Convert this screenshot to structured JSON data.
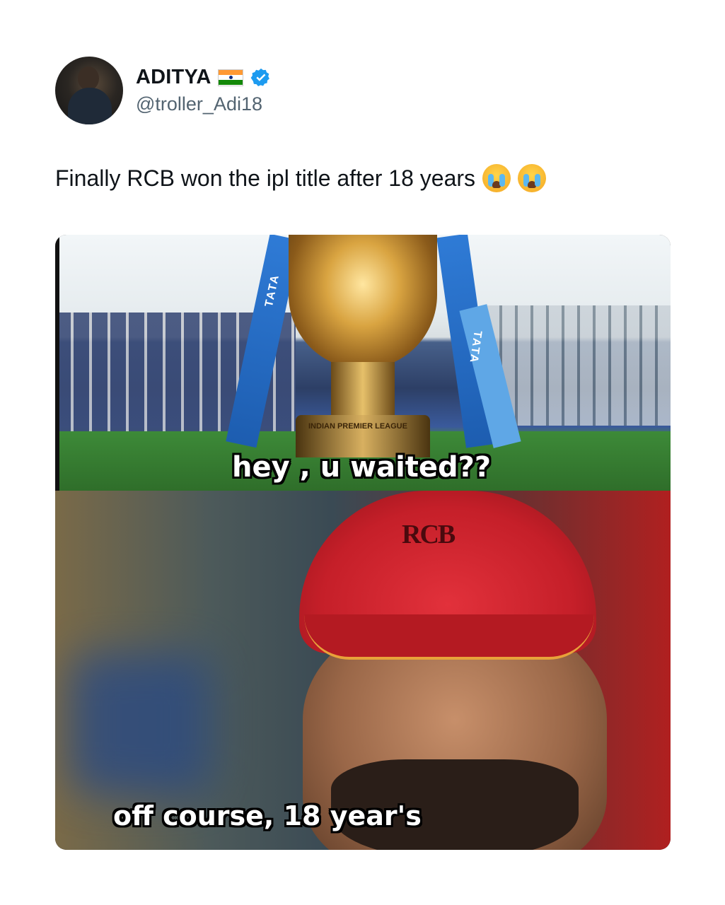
{
  "tweet": {
    "display_name": "ADITYA",
    "handle": "@troller_Adi18",
    "text": "Finally RCB won the ipl title after 18 years",
    "emojis": [
      "loudly-crying-face",
      "loudly-crying-face"
    ]
  },
  "meme": {
    "top_caption": "hey , u waited??",
    "bottom_caption": "off course, 18 year's",
    "trophy_text": "INDIAN PREMIER LEAGUE",
    "ribbon_text": "TATA",
    "cap_logo": "RCB"
  },
  "colors": {
    "verified": "#1d9bf0",
    "handle": "#536471",
    "flag_saffron": "#ff9933",
    "flag_white": "#ffffff",
    "flag_green": "#138808"
  }
}
